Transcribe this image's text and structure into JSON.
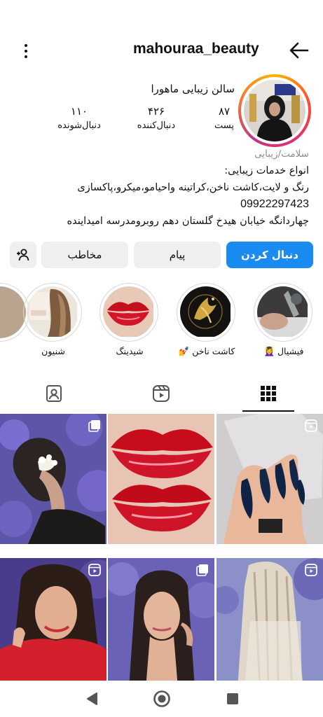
{
  "profile": {
    "username": "mahouraa_beauty",
    "display_name": "سالن زیبایی ماهورا",
    "stats": [
      {
        "value": "۸۷",
        "label": "پست"
      },
      {
        "value": "۴۲۶",
        "label": "دنبال‌کننده"
      },
      {
        "value": "۱۱۰",
        "label": "دنبال‌شونده"
      }
    ]
  },
  "bio": {
    "category": "سلامت/زیبایی",
    "line1": "انواع خدمات زیبایی:",
    "line2": "رنگ و لایت،کاشت ناخن،کراتینه واحیامو،میکرو،پاکسازی",
    "phone": "09922297423",
    "line3": "چهاردانگه خیابان هیدخ گلستان دهم روبرومدرسه امیداینده"
  },
  "actions": {
    "follow": "دنبال کردن",
    "message": "پیام",
    "contact": "مخاطب"
  },
  "highlights": [
    {
      "label": "فیشیال 💆‍♀️",
      "icon": "facial-highlight"
    },
    {
      "label": "کاشت ناخن 💅",
      "icon": "nails-logo-highlight"
    },
    {
      "label": "شیدینگ",
      "icon": "lips-highlight"
    },
    {
      "label": "شنیون",
      "icon": "hairstyle-highlight"
    }
  ],
  "tabs": [
    "grid-icon",
    "reels-icon",
    "tagged-icon"
  ],
  "colors": {
    "accent": "#1a8bf0",
    "button_bg": "#efefef",
    "category_text": "#8e8e8e"
  }
}
